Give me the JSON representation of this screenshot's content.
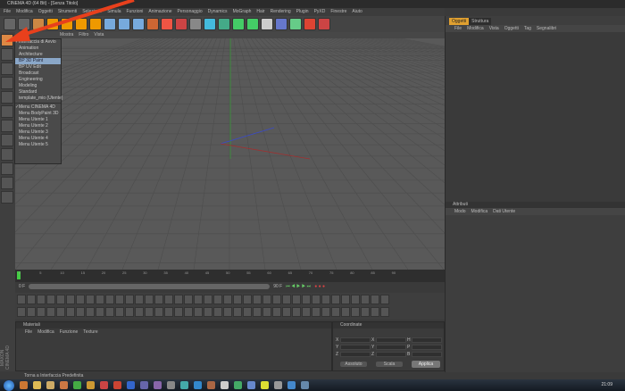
{
  "window": {
    "title": "CINEMA 4D (64 Bit) - [Senza Titolo]"
  },
  "menubar": [
    "File",
    "Modifica",
    "Oggetti",
    "Strumenti",
    "Selezione",
    "Simula",
    "Funzioni",
    "Animazione",
    "Personaggio",
    "Dynamics",
    "MoGraph",
    "Hair",
    "Rendering",
    "Plugin",
    "PyXD",
    "Finestre",
    "Aiuto"
  ],
  "viewport_menu": [
    "Mostra",
    "Filtro",
    "Vista"
  ],
  "layout_menu": {
    "items": [
      {
        "label": "Interfaccia di Avvio",
        "checked": true
      },
      {
        "label": "Animation"
      },
      {
        "label": "Architecture"
      },
      {
        "label": "BP 3D Paint",
        "selected": true
      },
      {
        "label": "BP UV Edit"
      },
      {
        "label": "Broadcast"
      },
      {
        "label": "Engineering"
      },
      {
        "label": "Modeling"
      },
      {
        "label": "Standard"
      },
      {
        "label": "template_mio (Utente)"
      },
      {
        "label": "Menu CINEMA 4D",
        "checked": true
      },
      {
        "label": "Menu BodyPaint 3D"
      },
      {
        "label": "Menu Utente 1"
      },
      {
        "label": "Menu Utente 2"
      },
      {
        "label": "Menu Utente 3"
      },
      {
        "label": "Menu Utente 4"
      },
      {
        "label": "Menu Utente 5"
      }
    ]
  },
  "objects_panel": {
    "tabs": [
      "Oggetti",
      "Struttura"
    ],
    "menu": [
      "File",
      "Modifica",
      "Vista",
      "Oggetti",
      "Tag",
      "Segnalibri"
    ]
  },
  "attributes_panel": {
    "title": "Attributi",
    "menu": [
      "Modo",
      "Modifica",
      "Dati Utente"
    ]
  },
  "timeline": {
    "ticks": [
      "0",
      "5",
      "10",
      "15",
      "20",
      "25",
      "30",
      "35",
      "40",
      "45",
      "50",
      "55",
      "60",
      "65",
      "70",
      "75",
      "80",
      "85",
      "90"
    ],
    "current_frame": "0 F",
    "start": "0 F",
    "range_start": "0 F",
    "range_end": "90 F",
    "end": "90 F"
  },
  "materials": {
    "title": "Materiali",
    "menu": [
      "File",
      "Modifica",
      "Funzione",
      "Texture"
    ]
  },
  "coordinates": {
    "title": "Coordinate",
    "rows": [
      [
        "X",
        "0",
        "X",
        "0",
        "H",
        "0"
      ],
      [
        "Y",
        "0",
        "Y",
        "0",
        "P",
        "0"
      ],
      [
        "Z",
        "0",
        "Z",
        "0",
        "B",
        "0"
      ]
    ],
    "mode1": "Assoluto",
    "mode2": "Scala",
    "apply": "Applica"
  },
  "status": "Torna a Interfaccia Predefinita",
  "brand": "MAXON CINEMA 4D",
  "clock": "21:09",
  "colors": {
    "accent_arrow": "#e8401c",
    "selected": "#8aa7c8"
  }
}
